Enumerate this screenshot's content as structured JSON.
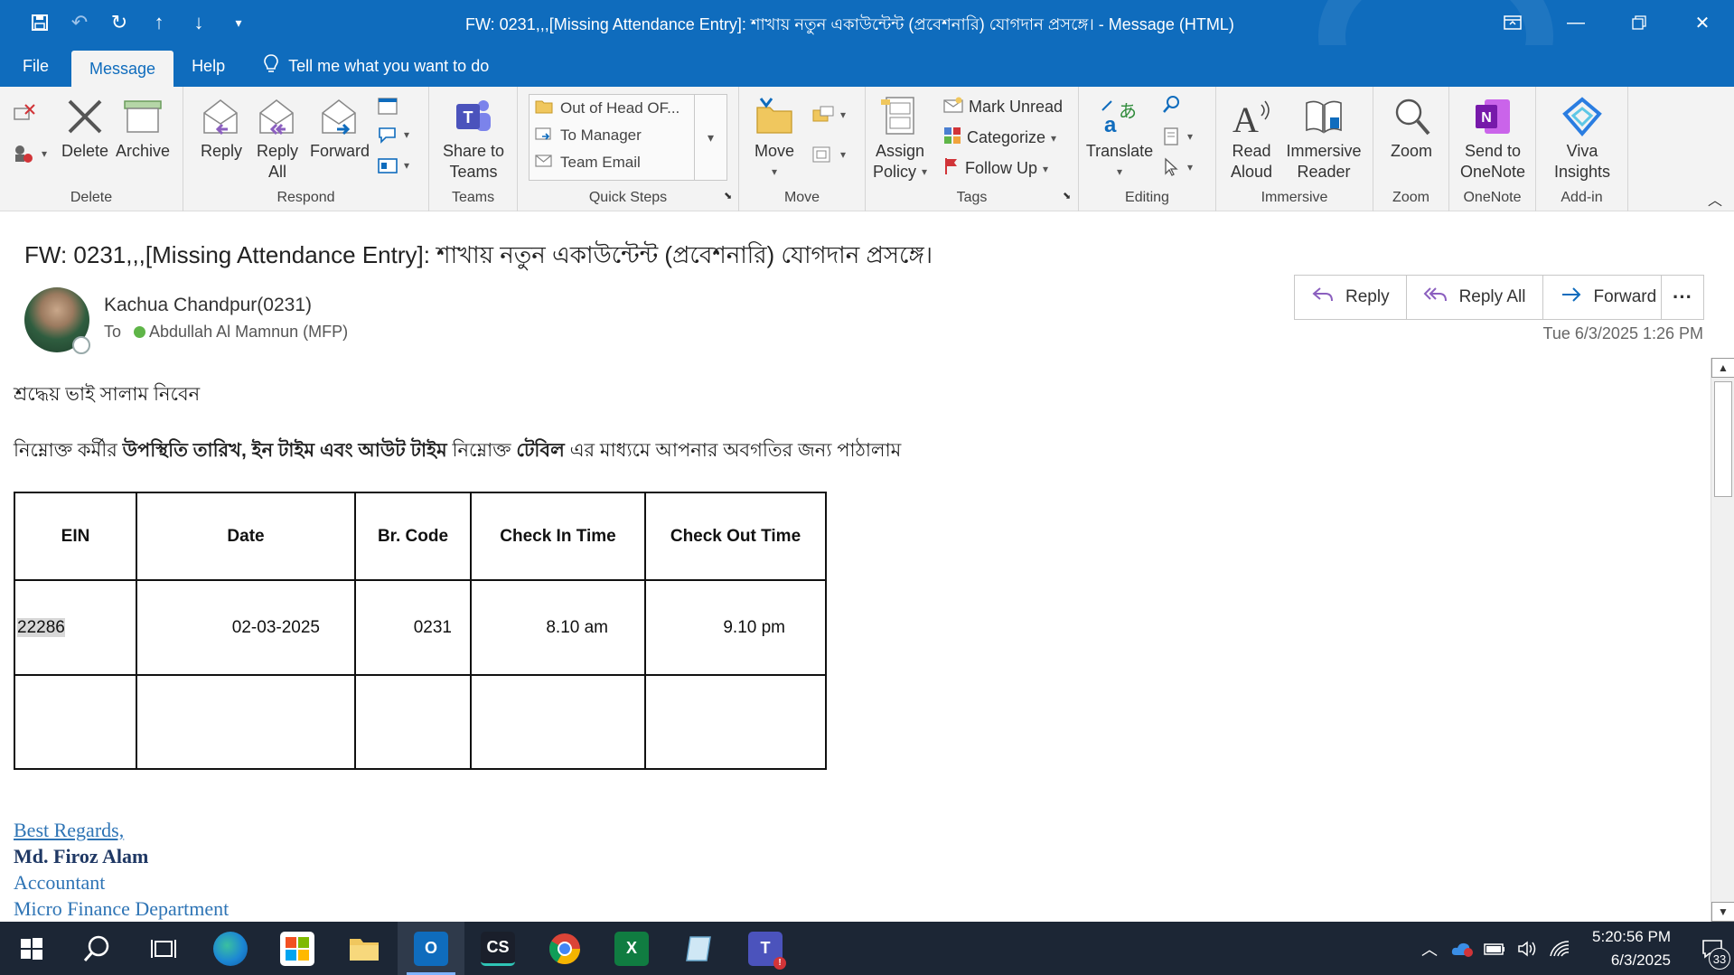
{
  "window": {
    "title": "FW:  0231,,,[Missing Attendance Entry]: শাখায় নতুন একাউন্টেন্ট (প্রবেশনারি) যোগদান প্রসঙ্গে।  -  Message (HTML)"
  },
  "menu": {
    "tabs": [
      "File",
      "Message",
      "Help"
    ],
    "active_tab": "Message",
    "tell_me": "Tell me what you want to do"
  },
  "ribbon": {
    "delete_group": {
      "label": "Delete",
      "delete": "Delete",
      "archive": "Archive"
    },
    "respond_group": {
      "label": "Respond",
      "reply": "Reply",
      "reply_all_1": "Reply",
      "reply_all_2": "All",
      "forward": "Forward"
    },
    "teams_group": {
      "label": "Teams",
      "share_1": "Share to",
      "share_2": "Teams"
    },
    "quick_steps": {
      "label": "Quick Steps",
      "items": [
        "Out of Head OF...",
        "To Manager",
        "Team Email"
      ]
    },
    "move_group": {
      "label": "Move",
      "move": "Move"
    },
    "tags_group": {
      "label": "Tags",
      "assign_1": "Assign",
      "assign_2": "Policy",
      "mark_unread": "Mark Unread",
      "categorize": "Categorize",
      "follow_up": "Follow Up"
    },
    "editing_group": {
      "label": "Editing",
      "translate": "Translate"
    },
    "immersive_group": {
      "label": "Immersive",
      "read_1": "Read",
      "read_2": "Aloud",
      "reader_1": "Immersive",
      "reader_2": "Reader"
    },
    "zoom_group": {
      "label": "Zoom",
      "zoom": "Zoom"
    },
    "onenote_group": {
      "label": "OneNote",
      "send_1": "Send to",
      "send_2": "OneNote"
    },
    "addin_group": {
      "label": "Add-in",
      "viva_1": "Viva",
      "viva_2": "Insights"
    }
  },
  "message": {
    "subject": "FW:  0231,,,[Missing Attendance Entry]: শাখায় নতুন একাউন্টেন্ট  (প্রবেশনারি)  যোগদান প্রসঙ্গে।",
    "sender": "Kachua Chandpur(0231)",
    "to_label": "To",
    "recipient": "Abdullah Al Mamnun (MFP)",
    "date": "Tue 6/3/2025 1:26 PM",
    "actions": {
      "reply": "Reply",
      "reply_all": "Reply All",
      "forward": "Forward"
    }
  },
  "body": {
    "greeting": "শ্রদ্ধেয়  ভাই  সালাম  নিবেন",
    "intro_1": "নিম্নোক্ত  কর্মীর ",
    "intro_bold_1": " উপস্থিতি তারিখ, ইন টাইম এবং আউট টাইম",
    "intro_2": " নিম্নোক্ত ",
    "intro_bold_2": "টেবিল",
    "intro_3": " এর  মাধ্যমে  আপনার  অবগতির  জন্য  পাঠালাম",
    "table": {
      "headers": [
        "EIN",
        "Date",
        "Br. Code",
        "Check In Time",
        "Check Out Time"
      ],
      "rows": [
        [
          "22286",
          "02-03-2025",
          "0231",
          "8.10 am",
          "9.10 pm"
        ],
        [
          "",
          "",
          "",
          "",
          ""
        ]
      ]
    },
    "signature": {
      "regards": "Best Regards,",
      "name": "Md. Firoz Alam",
      "title": "Accountant",
      "department": "Micro Finance Department"
    }
  },
  "taskbar": {
    "time": "5:20:56 PM",
    "date": "6/3/2025",
    "notifications": "33"
  },
  "colors": {
    "accent": "#0f6cbd",
    "taskbar": "#1c2635",
    "signature_blue": "#2e74b5",
    "signature_dark": "#1f3864"
  }
}
